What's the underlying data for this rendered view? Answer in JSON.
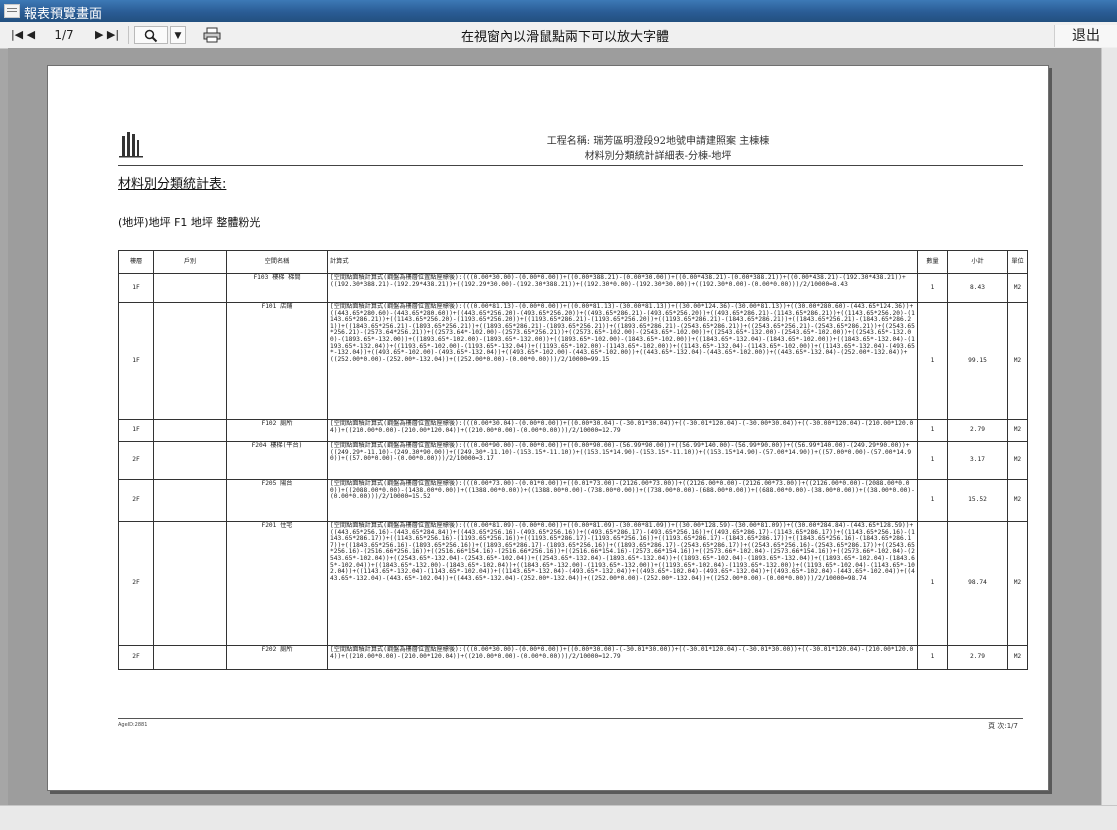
{
  "window": {
    "title": "報表預覽畫面"
  },
  "toolbar": {
    "first_prev": "|◀ ◀",
    "page_indicator": "1/7",
    "next_last": "▶ ▶|",
    "zoom_icon": "search-icon",
    "print_icon": "printer-icon",
    "hint": "在視窗內以滑鼠點兩下可以放大字體",
    "exit_label": "退出"
  },
  "report": {
    "project_title": "工程名稱:  瑞芳區明澄段92地號申請建照案  主棟棟",
    "project_subtitle": "材料別分類統計詳細表-分棟-地坪",
    "section_title": "材料別分類統計表:",
    "category": "(地坪)地坪 F1 地坪 整體粉光",
    "columns": [
      "樓層",
      "戶別",
      "空間名稱",
      "計算式",
      "數量",
      "小計",
      "單位"
    ],
    "rows": [
      {
        "floor": "1F",
        "unit_no": "",
        "space": "F103 樓梯 梯間",
        "formula": "[空間點面積計算式(鋼盤為樓層位置點座標後):(((0.00*30.00)-(0.00*0.00))+((0.00*388.21)-(0.00*30.00))+((0.00*438.21)-(0.00*388.21))+((0.00*438.21)-(192.30*438.21))+((192.30*388.21)-(192.29*438.21))+((192.29*30.00)-(192.30*388.21))+((192.30*0.00)-(192.30*30.00))+((192.30*0.00)-(0.00*0.00)))/2/10000=8.43",
        "qty": "1",
        "subtotal": "8.43",
        "unit": "M2"
      },
      {
        "floor": "1F",
        "unit_no": "",
        "space": "F101 店鋪",
        "formula": "[空間點面積計算式(鋼盤為樓層位置點座標後):(((0.00*81.13)-(0.00*0.00))+((0.00*81.13)-(30.00*81.13))+((30.00*124.36)-(30.00*81.13))+((30.00*280.60)-(443.65*124.36))+((443.65*280.60)-(443.65*280.60))+((443.65*256.20)-(493.65*256.20))+((493.65*286.21)-(493.65*256.20))+((493.65*286.21)-(1143.65*286.21))+((1143.65*256.20)-(1143.65*286.21))+((1143.65*256.20)-(1193.65*256.20))+((1193.65*286.21)-(1193.65*256.20))+((1193.65*286.21)-(1843.65*286.21))+((1843.65*256.21)-(1843.65*286.21))+((1843.65*256.21)-(1893.65*256.21))+((1893.65*286.21)-(1893.65*256.21))+((1893.65*286.21)-(2543.65*286.21))+((2543.65*256.21)-(2543.65*286.21))+((2543.65*256.21)-(2573.64*256.21))+((2573.64*-102.00)-(2573.65*256.21))+((2573.65*-102.00)-(2543.65*-102.00))+((2543.65*-132.00)-(2543.65*-102.00))+((2543.65*-132.00)-(1893.65*-132.00))+((1893.65*-102.00)-(1893.65*-132.00))+((1893.65*-102.00)-(1843.65*-102.00))+((1843.65*-132.04)-(1843.65*-102.00))+((1843.65*-132.04)-(1193.65*-132.04))+((1193.65*-102.00)-(1193.65*-132.04))+((1193.65*-102.00)-(1143.65*-102.00))+((1143.65*-132.04)-(1143.65*-102.00))+((1143.65*-132.04)-(493.65*-132.04))+((493.65*-102.00)-(493.65*-132.04))+((493.65*-102.00)-(443.65*-102.00))+((443.65*-132.04)-(443.65*-102.00))+((443.65*-132.04)-(252.00*-132.04))+((252.00*0.00)-(252.00*-132.04))+((252.00*0.00)-(0.00*0.00)))/2/10000=99.15",
        "qty": "1",
        "subtotal": "99.15",
        "unit": "M2"
      },
      {
        "floor": "1F",
        "unit_no": "",
        "space": "F102 廁所",
        "formula": "[空間點面積計算式(鋼盤為樓層位置點座標後):(((0.00*30.04)-(0.00*0.00))+((0.00*30.04)-(-30.01*30.04))+((-30.01*120.04)-(-30.00*30.04))+((-30.00*120.04)-(210.00*120.04))+((210.00*0.00)-(210.00*120.04))+((210.00*0.00)-(0.00*0.00)))/2/10000=12.79",
        "qty": "1",
        "subtotal": "2.79",
        "unit": "M2"
      },
      {
        "floor": "2F",
        "unit_no": "",
        "space": "F204 樓梯(平台)",
        "formula": "[空間點面積計算式(鋼盤為樓層位置點座標後):(((0.00*90.00)-(0.00*0.00))+((0.00*90.00)-(56.99*90.00))+((56.99*140.00)-(56.99*90.00))+((56.99*140.00)-(249.29*90.00))+((249.29*-11.10)-(249.30*90.00))+((249.30*-11.10)-(153.15*-11.10))+((153.15*14.90)-(153.15*-11.10))+((153.15*14.90)-(57.00*14.90))+((57.00*0.00)-(57.00*14.90))+((57.00*0.00)-(0.00*0.00)))/2/10000=3.17",
        "qty": "1",
        "subtotal": "3.17",
        "unit": "M2"
      },
      {
        "floor": "2F",
        "unit_no": "",
        "space": "F205 陽台",
        "formula": "[空間點面積計算式(鋼盤為樓層位置點座標後):(((0.00*73.00)-(0.01*0.00))+((0.01*73.00)-(2126.00*73.00))+((2126.00*0.00)-(2126.00*73.00))+((2126.00*0.00)-(2088.00*0.00))+((2088.00*0.00)-(1438.00*0.00))+((1388.00*0.00))+((1388.00*0.00)-(738.00*0.00))+((738.00*0.00)-(688.00*0.00))+((688.00*0.00)-(38.00*0.00))+((38.00*0.00)-(0.00*0.00)))/2/10000=15.52",
        "qty": "1",
        "subtotal": "15.52",
        "unit": "M2"
      },
      {
        "floor": "2F",
        "unit_no": "",
        "space": "F201 住宅",
        "formula": "[空間點面積計算式(鋼盤為樓層位置點座標後):(((0.00*81.09)-(0.00*0.00))+((0.00*81.09)-(30.00*81.09))+((30.00*128.59)-(30.00*81.09))+((30.00*284.84)-(443.65*128.59))+((443.65*256.16)-(443.65*284.84))+((443.65*256.16)-(493.65*256.16))+((493.65*286.17)-(493.65*256.16))+((493.65*286.17)-(1143.65*286.17))+((1143.65*256.16)-(1143.65*286.17))+((1143.65*256.16)-(1193.65*256.16))+((1193.65*286.17)-(1193.65*256.16))+((1193.65*286.17)-(1843.65*286.17))+((1843.65*256.16)-(1843.65*286.17))+((1843.65*256.16)-(1893.65*256.16))+((1893.65*286.17)-(1893.65*256.16))+((1893.65*286.17)-(2543.65*286.17))+((2543.65*256.16)-(2543.65*286.17))+((2543.65*256.16)-(2516.66*256.16))+((2516.66*154.16)-(2516.66*256.16))+((2516.66*154.16)-(2573.66*154.16))+((2573.66*-102.04)-(2573.66*154.16))+((2573.66*-102.04)-(2543.65*-102.04))+((2543.65*-132.04)-(2543.65*-102.04))+((2543.65*-132.04)-(1893.65*-132.04))+((1893.65*-102.04)-(1893.65*-132.04))+((1893.65*-102.04)-(1843.65*-102.04))+((1843.65*-132.00)-(1843.65*-102.04))+((1843.65*-132.00)-(1193.65*-132.00))+((1193.65*-102.04)-(1193.65*-132.00))+((1193.65*-102.04)-(1143.65*-102.04))+((1143.65*-132.04)-(1143.65*-102.04))+((1143.65*-132.04)-(493.65*-132.04))+((493.65*-102.04)-(493.65*-132.04))+((493.65*-102.04)-(443.65*-102.04))+((443.65*-132.04)-(443.65*-102.04))+((443.65*-132.04)-(252.00*-132.04))+((252.00*0.00)-(252.00*-132.04))+((252.00*0.00)-(0.00*0.00)))/2/10000=98.74",
        "qty": "1",
        "subtotal": "98.74",
        "unit": "M2"
      },
      {
        "floor": "2F",
        "unit_no": "",
        "space": "F202 廁所",
        "formula": "[空間點面積計算式(鋼盤為樓層位置點座標後):(((0.00*30.00)-(0.00*0.00))+((0.00*30.00)-(-30.01*30.00))+((-30.01*120.04)-(-30.01*30.00))+((-30.01*120.04)-(210.00*120.04))+((210.00*0.00)-(210.00*120.04))+((210.00*0.00)-(0.00*0.00)))/2/10000=12.79",
        "qty": "1",
        "subtotal": "2.79",
        "unit": "M2"
      }
    ],
    "footer_left": "AgeID:2881",
    "footer_right": "頁 次:1/7"
  }
}
